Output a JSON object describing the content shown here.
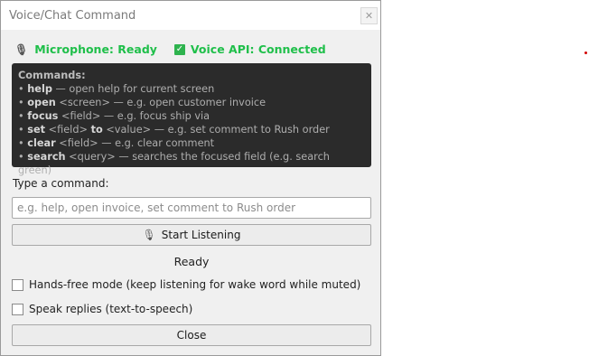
{
  "window": {
    "title": "Voice/Chat Command",
    "close_glyph": "✕"
  },
  "status": {
    "microphone": "Microphone: Ready",
    "voice_api": "Voice API: Connected",
    "microphone_icon": "microphone-icon",
    "check_icon": "checkmark-icon",
    "status_color": "#1fbf4a"
  },
  "commands": {
    "heading": "Commands:",
    "items": [
      {
        "bullet": "• ",
        "kw": "help",
        "rest": " — open help for current screen"
      },
      {
        "bullet": "• ",
        "kw": "open",
        "rest": " <screen> — e.g. open customer invoice"
      },
      {
        "bullet": "• ",
        "kw": "focus",
        "rest": " <field> — e.g. focus ship via"
      },
      {
        "bullet": "• ",
        "kw": "set",
        "rest": " <field> ",
        "kw2": "to",
        "rest2": " <value> — e.g. set comment to Rush order"
      },
      {
        "bullet": "• ",
        "kw": "clear",
        "rest": " <field> — e.g. clear comment"
      },
      {
        "bullet": "• ",
        "kw": "search",
        "rest": " <query> — searches the focused field (e.g. search green)"
      }
    ]
  },
  "input": {
    "label": "Type a command:",
    "placeholder": "e.g. help, open invoice, set comment to Rush order",
    "value": ""
  },
  "buttons": {
    "listen_icon": "🎙",
    "listen_label": "Start Listening",
    "close_label": "Close"
  },
  "state_text": "Ready",
  "options": {
    "hands_free": {
      "label": "Hands-free mode (keep listening for wake word while muted)",
      "checked": false
    },
    "speak_replies": {
      "label": "Speak replies (text-to-speech)",
      "checked": false
    }
  }
}
